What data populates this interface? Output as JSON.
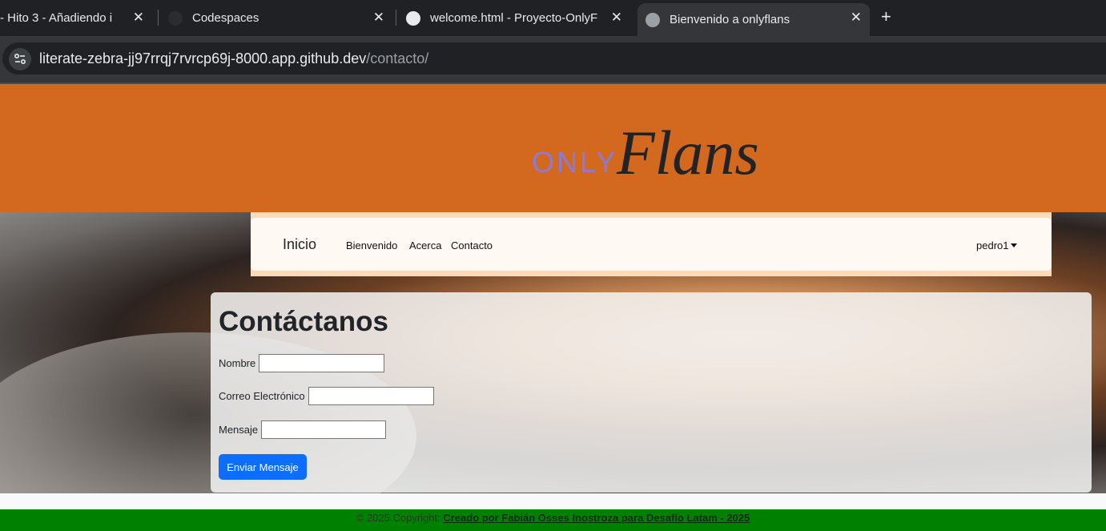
{
  "browser": {
    "tabs": [
      {
        "title": "- Hito 3 - Añadiendo i"
      },
      {
        "title": "Codespaces"
      },
      {
        "title": "welcome.html - Proyecto-OnlyF"
      },
      {
        "title": "Bienvenido a onlyflans"
      }
    ],
    "new_tab": "+",
    "close": "✕",
    "url_host": "literate-zebra-jj97rrqj7rvrcp69j-8000.app.github.dev",
    "url_path": "/contacto/"
  },
  "logo": {
    "only": "ONLY",
    "flans": "Flans"
  },
  "nav": {
    "brand": "Inicio",
    "links": [
      "Bienvenido",
      "Acerca",
      "Contacto"
    ],
    "user": "pedro1"
  },
  "form": {
    "title": "Contáctanos",
    "name_label": "Nombre",
    "email_label": "Correo Electrónico",
    "message_label": "Mensaje",
    "submit": "Enviar Mensaje"
  },
  "footer": {
    "prefix": "© 2025 Copyright: ",
    "link": "Creado por Fabián Osses Inostroza para Desafío Latam - 2025"
  },
  "colors": {
    "banner": "#d2691e",
    "footer": "#008000",
    "button": "#0d6efd"
  }
}
